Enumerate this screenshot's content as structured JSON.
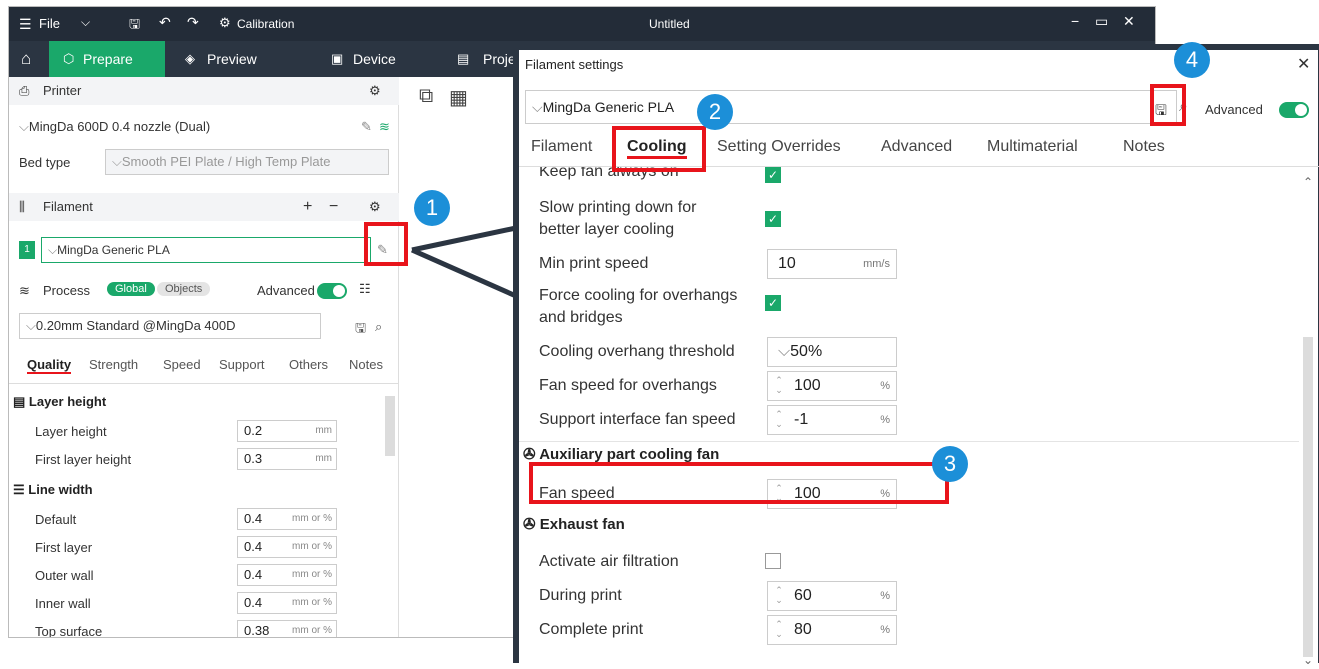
{
  "titlebar": {
    "file_label": "File",
    "calibration_label": "Calibration",
    "doc_title": "Untitled"
  },
  "nav": {
    "home": "",
    "tabs": [
      {
        "label": "Prepare"
      },
      {
        "label": "Preview"
      },
      {
        "label": "Device"
      },
      {
        "label": "Proje"
      }
    ]
  },
  "sidebar": {
    "printer_header": "Printer",
    "printer_value": "MingDa 600D 0.4 nozzle (Dual)",
    "bed_type_label": "Bed type",
    "bed_type_value": "Smooth PEI Plate / High Temp Plate",
    "filament_header": "Filament",
    "filament_index": "1",
    "filament_value": "MingDa Generic PLA",
    "process_header": "Process",
    "process_global": "Global",
    "process_objects": "Objects",
    "process_advanced": "Advanced",
    "process_value": "0.20mm Standard @MingDa 400D",
    "tabs": [
      "Quality",
      "Strength",
      "Speed",
      "Support",
      "Others",
      "Notes"
    ],
    "groups": [
      {
        "title": "Layer height",
        "rows": [
          {
            "label": "Layer height",
            "value": "0.2",
            "unit": "mm"
          },
          {
            "label": "First layer height",
            "value": "0.3",
            "unit": "mm"
          }
        ]
      },
      {
        "title": "Line width",
        "rows": [
          {
            "label": "Default",
            "value": "0.4",
            "unit": "mm or %"
          },
          {
            "label": "First layer",
            "value": "0.4",
            "unit": "mm or %"
          },
          {
            "label": "Outer wall",
            "value": "0.4",
            "unit": "mm or %"
          },
          {
            "label": "Inner wall",
            "value": "0.4",
            "unit": "mm or %"
          },
          {
            "label": "Top surface",
            "value": "0.38",
            "unit": "mm or %"
          }
        ]
      }
    ]
  },
  "dialog": {
    "title": "Filament settings",
    "preset": "MingDa Generic PLA",
    "advanced_label": "Advanced",
    "tabs": [
      "Filament",
      "Cooling",
      "Setting Overrides",
      "Advanced",
      "Multimaterial",
      "Notes"
    ],
    "rows": {
      "keep_fan": "Keep fan always on",
      "slow_print_1": "Slow printing down for",
      "slow_print_2": "better layer cooling",
      "min_speed": "Min print speed",
      "min_speed_value": "10",
      "min_speed_unit": "mm/s",
      "force_cool_1": "Force cooling for overhangs",
      "force_cool_2": "and bridges",
      "overhang_threshold": "Cooling overhang threshold",
      "overhang_threshold_value": "50%",
      "fan_overhang": "Fan speed for overhangs",
      "fan_overhang_value": "100",
      "fan_overhang_unit": "%",
      "support_fan": "Support interface fan speed",
      "support_fan_value": "-1",
      "support_fan_unit": "%",
      "aux_group": "Auxiliary part cooling fan",
      "fan_speed": "Fan speed",
      "fan_speed_value": "100",
      "fan_speed_unit": "%",
      "exhaust_group": "Exhaust fan",
      "air_filter": "Activate air filtration",
      "during_print": "During print",
      "during_print_value": "60",
      "during_print_unit": "%",
      "complete_print": "Complete print",
      "complete_print_value": "80",
      "complete_print_unit": "%"
    }
  },
  "callouts": [
    "1",
    "2",
    "3",
    "4"
  ],
  "colors": {
    "accent": "#1aa86a",
    "callout": "#1c8fd8",
    "highlight": "#e8141b",
    "titlebar": "#232c38"
  }
}
